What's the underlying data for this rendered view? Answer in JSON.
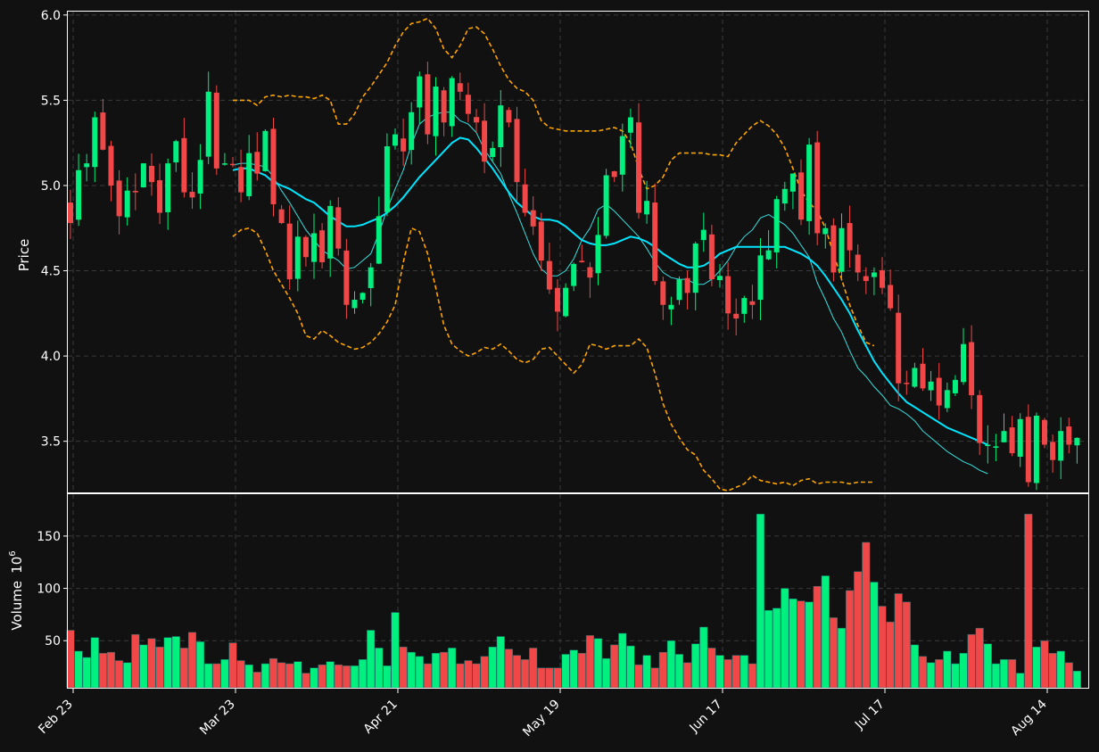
{
  "chart_data": {
    "type": "candlestick",
    "colors": {
      "background": "#111111",
      "up": "#00f07f",
      "down": "#f04848",
      "ma_fast": "#36e0e0",
      "ma_slow": "#00e5ff",
      "bollinger": "#ffa500",
      "grid": "#3a3a3a",
      "text": "#ffffff"
    },
    "price_panel": {
      "ylabel": "Price",
      "ylim": [
        3.2,
        6.02
      ],
      "yticks": [
        "3.5",
        "4.0",
        "4.5",
        "5.0",
        "5.5",
        "6.0"
      ],
      "grid": true
    },
    "volume_panel": {
      "ylabel": "Volume",
      "ylabel_exp": "10",
      "ylabel_sup": "6",
      "ylim": [
        5,
        190
      ],
      "yticks": [
        "50",
        "100",
        "150"
      ],
      "grid": true
    },
    "x_ticks": [
      {
        "label": "Feb 23",
        "index": 0
      },
      {
        "label": "Mar 23",
        "index": 20
      },
      {
        "label": "Apr 21",
        "index": 40
      },
      {
        "label": "May 19",
        "index": 60
      },
      {
        "label": "Jun 17",
        "index": 80
      },
      {
        "label": "Jul 17",
        "index": 100
      },
      {
        "label": "Aug 14",
        "index": 120
      }
    ],
    "n_sessions": 125,
    "closes": [
      4.78,
      5.09,
      5.13,
      5.4,
      5.21,
      5.0,
      4.82,
      4.97,
      4.96,
      5.13,
      5.02,
      4.84,
      5.13,
      5.26,
      4.96,
      4.93,
      5.15,
      5.55,
      5.1,
      5.13,
      5.12,
      4.96,
      5.19,
      5.07,
      5.32,
      4.89,
      4.78,
      4.45,
      4.7,
      4.58,
      4.72,
      4.55,
      4.88,
      4.63,
      4.3,
      4.33,
      4.37,
      4.52,
      4.82,
      5.23,
      5.3,
      5.2,
      5.43,
      5.64,
      5.3,
      5.58,
      5.37,
      5.63,
      5.55,
      5.42,
      5.37,
      5.14,
      5.22,
      5.47,
      5.37,
      5.02,
      4.84,
      4.76,
      4.56,
      4.39,
      4.26,
      4.4,
      4.54,
      4.55,
      4.46,
      4.71,
      5.06,
      5.05,
      5.29,
      5.4,
      4.84,
      4.91,
      4.44,
      4.3,
      4.3,
      4.45,
      4.37,
      4.66,
      4.74,
      4.45,
      4.47,
      4.25,
      4.22,
      4.34,
      4.3,
      4.59,
      4.62,
      4.92,
      4.98,
      5.07,
      4.8,
      5.24,
      4.72,
      4.75,
      4.49,
      4.75,
      4.62,
      4.49,
      4.44,
      4.49,
      4.4,
      4.28,
      3.84,
      3.84,
      3.93,
      3.81,
      3.85,
      3.71,
      3.8,
      3.86,
      4.07,
      3.77,
      3.49,
      3.48,
      3.47,
      3.56,
      3.43,
      3.63,
      3.26,
      3.65,
      3.48,
      3.39,
      3.56,
      3.48,
      3.52
    ],
    "sma_fast": [
      null,
      null,
      null,
      null,
      null,
      null,
      null,
      null,
      null,
      null,
      null,
      null,
      null,
      null,
      null,
      null,
      null,
      null,
      null,
      null,
      5.12,
      5.13,
      5.13,
      5.12,
      5.11,
      5.05,
      4.97,
      4.9,
      4.82,
      4.74,
      4.68,
      4.62,
      4.59,
      4.56,
      4.51,
      4.52,
      4.56,
      4.6,
      4.72,
      4.86,
      4.98,
      5.09,
      5.24,
      5.36,
      5.4,
      5.42,
      5.43,
      5.43,
      5.38,
      5.36,
      5.31,
      5.21,
      5.14,
      5.07,
      4.95,
      4.84,
      4.72,
      4.6,
      4.51,
      4.47,
      4.47,
      4.5,
      4.57,
      4.68,
      4.75,
      4.86,
      4.89,
      4.85,
      4.8,
      4.75,
      4.7,
      4.63,
      4.55,
      4.49,
      4.46,
      4.45,
      4.45,
      4.42,
      4.42,
      4.45,
      4.5,
      4.56,
      4.64,
      4.7,
      4.74,
      4.81,
      4.83,
      4.8,
      4.77,
      4.72,
      4.65,
      4.58,
      4.43,
      4.33,
      4.22,
      4.14,
      4.03,
      3.93,
      3.88,
      3.82,
      3.77,
      3.71,
      3.69,
      3.66,
      3.62,
      3.56,
      3.52,
      3.48,
      3.44,
      3.41,
      3.38,
      3.36,
      3.33,
      3.31
    ],
    "sma_slow": [
      null,
      null,
      null,
      null,
      null,
      null,
      null,
      null,
      null,
      null,
      null,
      null,
      null,
      null,
      null,
      null,
      null,
      null,
      null,
      null,
      5.09,
      5.1,
      5.1,
      5.08,
      5.06,
      5.02,
      5.0,
      4.98,
      4.95,
      4.92,
      4.9,
      4.86,
      4.82,
      4.79,
      4.76,
      4.76,
      4.77,
      4.79,
      4.81,
      4.84,
      4.88,
      4.93,
      4.99,
      5.05,
      5.1,
      5.15,
      5.2,
      5.25,
      5.28,
      5.27,
      5.22,
      5.16,
      5.1,
      5.03,
      4.96,
      4.9,
      4.86,
      4.82,
      4.8,
      4.8,
      4.79,
      4.76,
      4.72,
      4.68,
      4.66,
      4.65,
      4.65,
      4.66,
      4.68,
      4.7,
      4.69,
      4.67,
      4.64,
      4.6,
      4.57,
      4.54,
      4.52,
      4.52,
      4.53,
      4.56,
      4.6,
      4.62,
      4.64,
      4.64,
      4.64,
      4.64,
      4.64,
      4.64,
      4.64,
      4.62,
      4.6,
      4.57,
      4.53,
      4.47,
      4.4,
      4.33,
      4.25,
      4.15,
      4.06,
      3.97,
      3.9,
      3.84,
      3.78,
      3.73,
      3.7,
      3.67,
      3.64,
      3.61,
      3.58,
      3.56,
      3.54,
      3.52,
      3.5,
      3.48
    ],
    "bb_upper": [
      null,
      null,
      null,
      null,
      null,
      null,
      null,
      null,
      null,
      null,
      null,
      null,
      null,
      null,
      null,
      null,
      null,
      null,
      null,
      null,
      5.5,
      5.5,
      5.5,
      5.47,
      5.52,
      5.53,
      5.52,
      5.53,
      5.52,
      5.52,
      5.51,
      5.53,
      5.5,
      5.36,
      5.36,
      5.42,
      5.52,
      5.58,
      5.65,
      5.72,
      5.82,
      5.9,
      5.95,
      5.96,
      5.98,
      5.92,
      5.8,
      5.75,
      5.82,
      5.92,
      5.93,
      5.89,
      5.8,
      5.7,
      5.62,
      5.57,
      5.55,
      5.5,
      5.38,
      5.34,
      5.33,
      5.32,
      5.32,
      5.32,
      5.32,
      5.32,
      5.33,
      5.34,
      5.32,
      5.25,
      5.1,
      4.98,
      5.0,
      5.05,
      5.15,
      5.19,
      5.19,
      5.19,
      5.19,
      5.18,
      5.18,
      5.17,
      5.25,
      5.3,
      5.35,
      5.38,
      5.35,
      5.3,
      5.22,
      5.1,
      4.97,
      4.9,
      4.85,
      4.75,
      4.6,
      4.45,
      4.3,
      4.18,
      4.08,
      4.06
    ],
    "bb_lower": [
      null,
      null,
      null,
      null,
      null,
      null,
      null,
      null,
      null,
      null,
      null,
      null,
      null,
      null,
      null,
      null,
      null,
      null,
      null,
      null,
      4.7,
      4.74,
      4.75,
      4.72,
      4.62,
      4.5,
      4.42,
      4.34,
      4.25,
      4.12,
      4.1,
      4.15,
      4.12,
      4.08,
      4.06,
      4.04,
      4.05,
      4.08,
      4.13,
      4.2,
      4.3,
      4.55,
      4.75,
      4.73,
      4.6,
      4.4,
      4.18,
      4.07,
      4.03,
      4.0,
      4.02,
      4.05,
      4.04,
      4.07,
      4.03,
      3.98,
      3.96,
      3.98,
      4.04,
      4.05,
      4.0,
      3.95,
      3.9,
      3.95,
      4.07,
      4.06,
      4.04,
      4.06,
      4.06,
      4.06,
      4.1,
      4.05,
      3.9,
      3.72,
      3.6,
      3.52,
      3.45,
      3.42,
      3.33,
      3.28,
      3.22,
      3.21,
      3.23,
      3.25,
      3.3,
      3.27,
      3.26,
      3.25,
      3.26,
      3.24,
      3.27,
      3.28,
      3.25,
      3.26,
      3.26,
      3.26,
      3.25,
      3.26,
      3.26,
      3.26
    ],
    "volume_millions": [
      60,
      40,
      34,
      53,
      38,
      39,
      31,
      29,
      56,
      46,
      52,
      44,
      53,
      54,
      43,
      58,
      49,
      28,
      28,
      32,
      48,
      31,
      27,
      20,
      28,
      33,
      29,
      28,
      30,
      19,
      24,
      27,
      30,
      27,
      26,
      26,
      32,
      60,
      43,
      26,
      77,
      44,
      39,
      35,
      28,
      38,
      39,
      43,
      28,
      31,
      28,
      35,
      44,
      54,
      42,
      36,
      32,
      43,
      24,
      24,
      24,
      37,
      41,
      38,
      55,
      52,
      33,
      46,
      57,
      45,
      27,
      36,
      24,
      39,
      50,
      37,
      29,
      47,
      63,
      43,
      36,
      32,
      36,
      36,
      28,
      171,
      79,
      81,
      100,
      90,
      88,
      87,
      102,
      112,
      72,
      62,
      98,
      116,
      144,
      106,
      83,
      68,
      95,
      87,
      46,
      35,
      29,
      32,
      40,
      28,
      38,
      56,
      62,
      47,
      28,
      32,
      32,
      19,
      171,
      44,
      50,
      38,
      40,
      29,
      21
    ]
  }
}
